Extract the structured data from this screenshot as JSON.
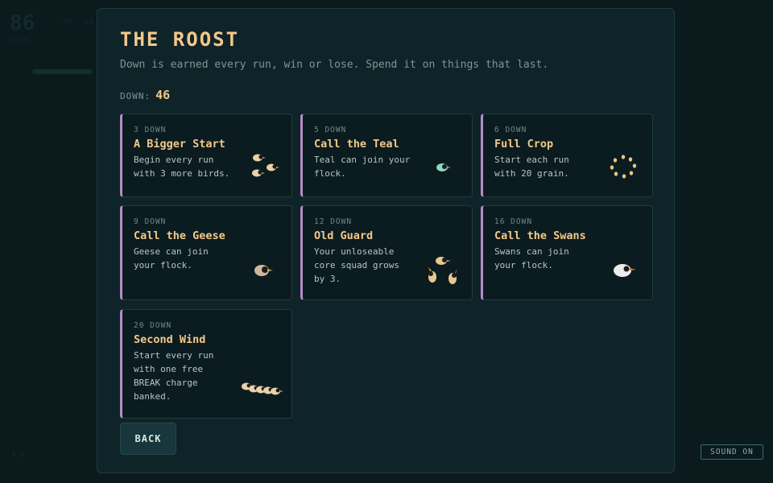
{
  "background": {
    "score": "86",
    "score_label": "BIRDS",
    "stats": [
      "45",
      "58"
    ],
    "footer": "4 2"
  },
  "panel": {
    "title": "THE ROOST",
    "subtitle": "Down is earned every run, win or lose. Spend it on things that last.",
    "down_label": "DOWN:",
    "down_value": "46"
  },
  "upgrades": [
    {
      "cost": "3 DOWN",
      "name": "A Bigger Start",
      "desc": "Begin every run with 3 more birds.",
      "icon": "three-birds-icon"
    },
    {
      "cost": "5 DOWN",
      "name": "Call the Teal",
      "desc": "Teal can join your flock.",
      "icon": "teal-bird-icon"
    },
    {
      "cost": "6 DOWN",
      "name": "Full Crop",
      "desc": "Start each run with 20 grain.",
      "icon": "grain-ring-icon"
    },
    {
      "cost": "9 DOWN",
      "name": "Call the Geese",
      "desc": "Geese can join your flock.",
      "icon": "goose-icon"
    },
    {
      "cost": "12 DOWN",
      "name": "Old Guard",
      "desc": "Your unloseable core squad grows by 3.",
      "icon": "squad-birds-icon"
    },
    {
      "cost": "16 DOWN",
      "name": "Call the Swans",
      "desc": "Swans can join your flock.",
      "icon": "swan-icon"
    },
    {
      "cost": "20 DOWN",
      "name": "Second Wind",
      "desc": "Start every run with one free BREAK charge banked.",
      "icon": "bird-chain-icon"
    }
  ],
  "buttons": {
    "back": "BACK",
    "sound": "SOUND ON"
  },
  "colors": {
    "accent": "#f4c88a",
    "card_border_accent": "#b48cc9",
    "panel_bg": "#0f2428"
  }
}
